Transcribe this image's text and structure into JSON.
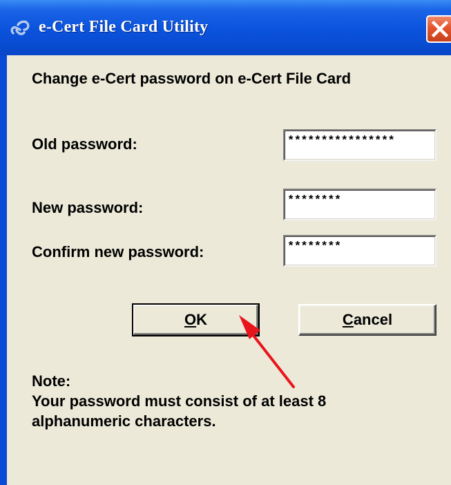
{
  "window": {
    "title": "e-Cert File Card Utility"
  },
  "dialog": {
    "heading": "Change e-Cert password on e-Cert File Card",
    "old_password_label": "Old password:",
    "old_password_value": "****************",
    "new_password_label": "New password:",
    "new_password_value": "********",
    "confirm_password_label": "Confirm new password:",
    "confirm_password_value": "********",
    "ok_label_mnemonic": "O",
    "ok_label_rest": "K",
    "cancel_label_mnemonic": "C",
    "cancel_label_rest": "ancel",
    "note_title": "Note:",
    "note_line1": "Your password must consist of at least 8",
    "note_line2": "alphanumeric characters."
  },
  "annotation": {
    "arrow_color": "#e8151c"
  },
  "colors": {
    "titlebar": "#0a52dc",
    "dialog_bg": "#ece9d8",
    "close_button": "#e2552e"
  },
  "icons": {
    "title": "chain-link-icon",
    "close": "close-icon"
  }
}
